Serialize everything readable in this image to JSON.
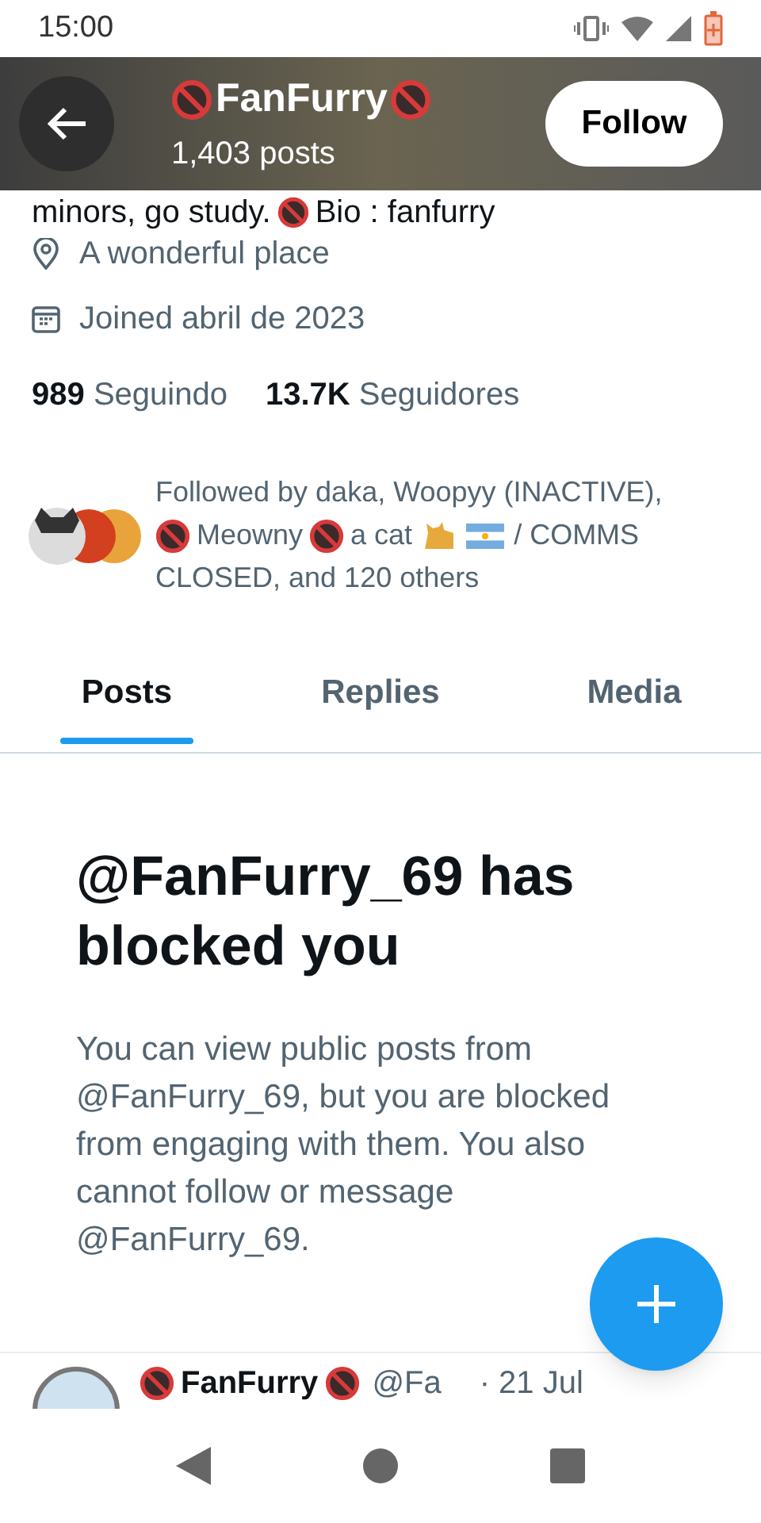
{
  "status_bar": {
    "time": "15:00"
  },
  "header": {
    "name": "FanFurry",
    "posts": "1,403 posts",
    "follow_button": "Follow"
  },
  "bio_tail": {
    "before": "minors, go study.",
    "after": "Bio : fanfurry"
  },
  "location": "A wonderful place",
  "joined": "Joined abril de 2023",
  "stats": [
    {
      "count": "989",
      "label": "Seguindo"
    },
    {
      "count": "13.7K",
      "label": "Seguidores"
    }
  ],
  "followed_by": [
    {
      "kind": "text",
      "text": "Followed by daka, Woopyy (INACTIVE),"
    },
    {
      "kind": "line_break"
    },
    {
      "kind": "adult_icon"
    },
    {
      "kind": "text",
      "text": "Meowny"
    },
    {
      "kind": "adult_icon"
    },
    {
      "kind": "text",
      "text": "a cat"
    },
    {
      "kind": "dog_icon"
    },
    {
      "kind": "flag_icon"
    },
    {
      "kind": "text",
      "text": "/ COMMS"
    },
    {
      "kind": "line_break"
    },
    {
      "kind": "text",
      "text": "CLOSED, and 120 others"
    }
  ],
  "tabs": [
    {
      "label": "Posts",
      "selected": true
    },
    {
      "label": "Replies",
      "selected": false
    },
    {
      "label": "Media",
      "selected": false
    }
  ],
  "blocked": {
    "title": "@FanFurry_69 has blocked you",
    "message": "You can view public posts from @FanFurry_69, but you are blocked from engaging with them. You also cannot follow or message @FanFurry_69."
  },
  "post_preview": {
    "name": "FanFurry",
    "handle": "@Fa",
    "date": "· 21 Jul"
  }
}
